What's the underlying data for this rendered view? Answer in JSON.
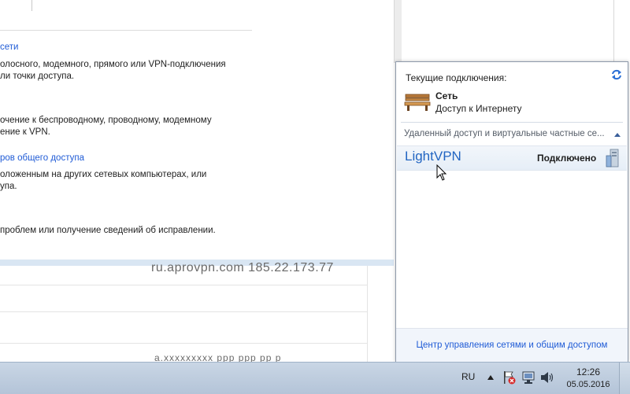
{
  "background_window": {
    "link_network": "сети",
    "text_line1": "олосного, модемного, прямого или VPN-подключения",
    "text_line2": "ли точки доступа.",
    "text_line3": "очение к беспроводному, проводному, модемному",
    "text_line4": "ение к VPN.",
    "link_sharing": "ров общего доступа",
    "text_line5": "оложенным на других сетевых компьютерах, или",
    "text_line6": "упа.",
    "text_line7": "проблем или получение сведений об исправлении."
  },
  "list_window": {
    "ghost_row_top": "ru.aprovpn.com        185.22.173.77",
    "ghost_row_bottom": "а.ххххххххх ррр  ррр рр р"
  },
  "flyout": {
    "current_connections_label": "Текущие подключения:",
    "refresh_icon": "refresh-icon",
    "connection": {
      "name": "Сеть",
      "status": "Доступ к Интернету",
      "icon": "bench-network-icon"
    },
    "section_header": "Удаленный доступ и виртуальные частные се...",
    "vpn": {
      "name": "LightVPN",
      "state": "Подключено",
      "icon": "vpn-connection-icon"
    },
    "footer_link": "Центр управления сетями и общим доступом"
  },
  "taskbar": {
    "language": "RU",
    "time": "12:26",
    "date": "05.05.2016"
  },
  "colors": {
    "link": "#1f5bd6",
    "vpn_name": "#2265c2",
    "taskbar": "#c3d1e2"
  }
}
